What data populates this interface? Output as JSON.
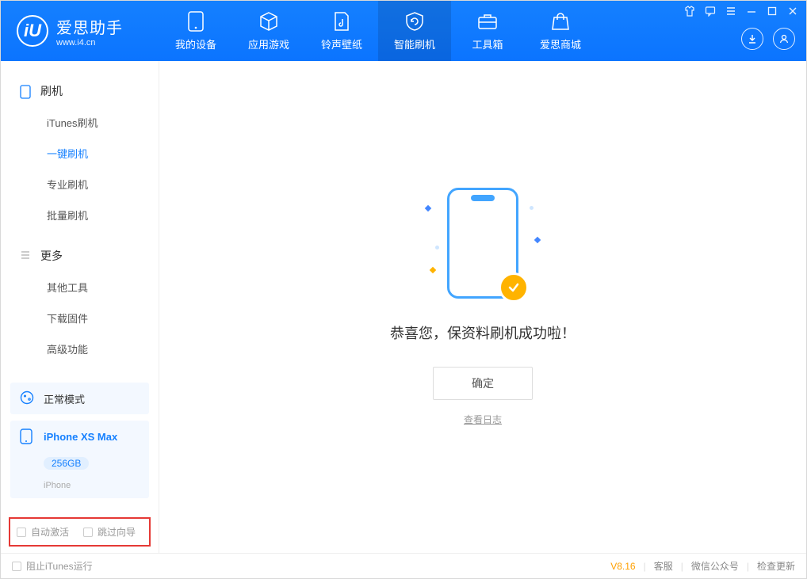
{
  "app": {
    "title": "爱思助手",
    "url": "www.i4.cn",
    "logo_letter": "iU"
  },
  "tabs": {
    "device": "我的设备",
    "apps": "应用游戏",
    "ring": "铃声壁纸",
    "flash": "智能刷机",
    "tools": "工具箱",
    "store": "爱思商城"
  },
  "sidebar": {
    "group_flash": "刷机",
    "items_flash": {
      "itunes": "iTunes刷机",
      "oneclick": "一键刷机",
      "pro": "专业刷机",
      "batch": "批量刷机"
    },
    "group_more": "更多",
    "items_more": {
      "other": "其他工具",
      "firmware": "下载固件",
      "adv": "高级功能"
    }
  },
  "status_card": {
    "label": "正常模式"
  },
  "device": {
    "name": "iPhone XS Max",
    "capacity": "256GB",
    "kind": "iPhone"
  },
  "options": {
    "auto_activate": "自动激活",
    "skip_guide": "跳过向导"
  },
  "main": {
    "success": "恭喜您，保资料刷机成功啦！",
    "ok": "确定",
    "view_log": "查看日志"
  },
  "statusbar": {
    "block_itunes": "阻止iTunes运行",
    "version": "V8.16",
    "support": "客服",
    "wechat": "微信公众号",
    "update": "检查更新"
  }
}
